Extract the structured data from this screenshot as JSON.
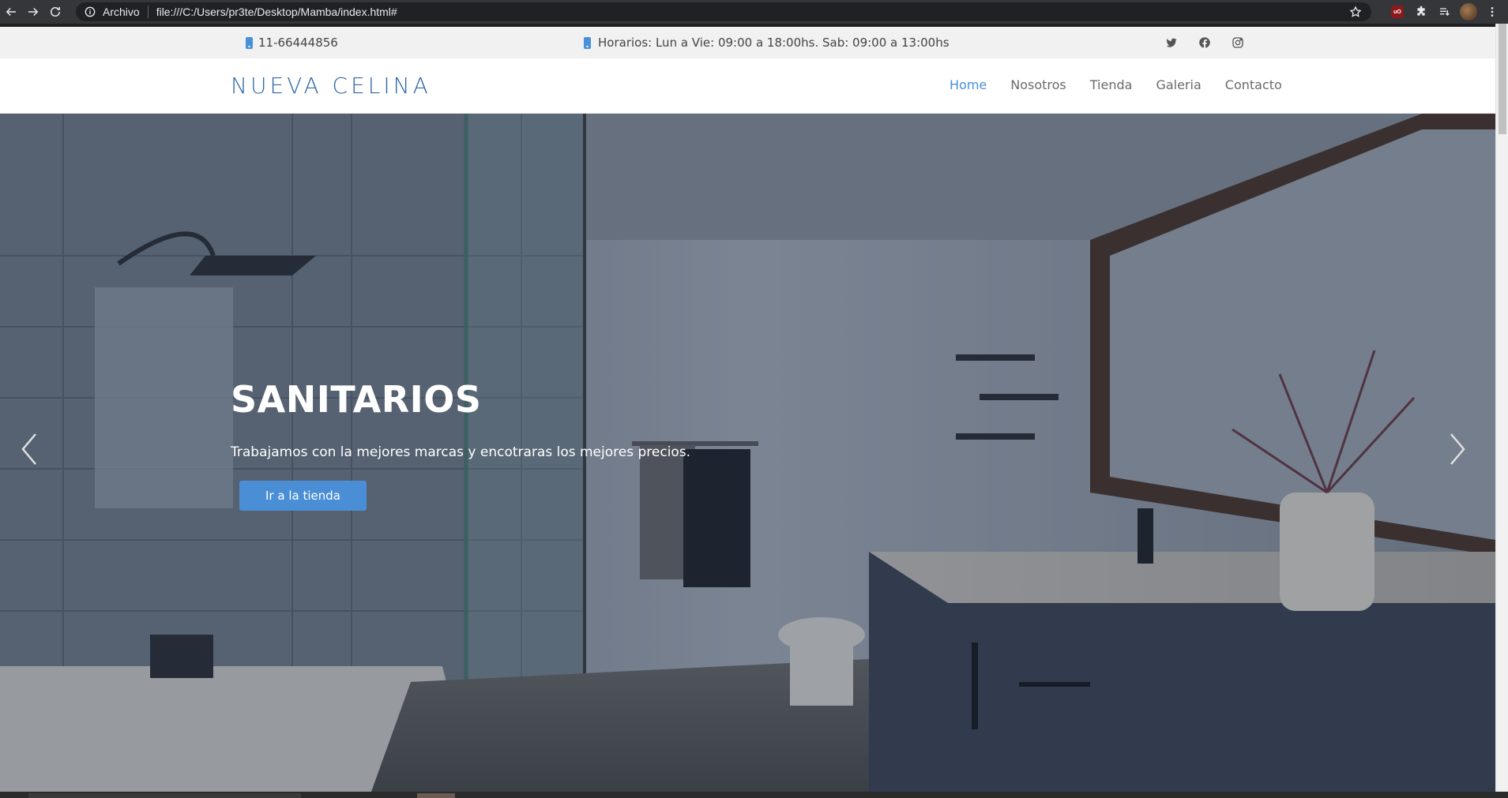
{
  "browser": {
    "secure_label": "Archivo",
    "url": "file:///C:/Users/pr3te/Desktop/Mamba/index.html#"
  },
  "topbar": {
    "phone": "11-66444856",
    "hours": "Horarios: Lun a Vie: 09:00 a 18:00hs. Sab: 09:00 a 13:00hs",
    "socials": [
      "twitter-icon",
      "facebook-icon",
      "instagram-icon"
    ]
  },
  "header": {
    "logo": "NUEVA CELINA",
    "menu": [
      {
        "label": "Home",
        "active": true
      },
      {
        "label": "Nosotros",
        "active": false
      },
      {
        "label": "Tienda",
        "active": false
      },
      {
        "label": "Galeria",
        "active": false
      },
      {
        "label": "Contacto",
        "active": false
      }
    ]
  },
  "hero": {
    "title": "SANITARIOS",
    "subtitle": "Trabajamos con la mejores marcas y encotraras los mejores precios.",
    "cta_label": "Ir a la tienda",
    "slides_count": 3,
    "active_slide": 0
  },
  "colors": {
    "accent": "#4a8fd6",
    "logo": "#2f6aa6",
    "topbar_bg": "#f1f1f1"
  }
}
